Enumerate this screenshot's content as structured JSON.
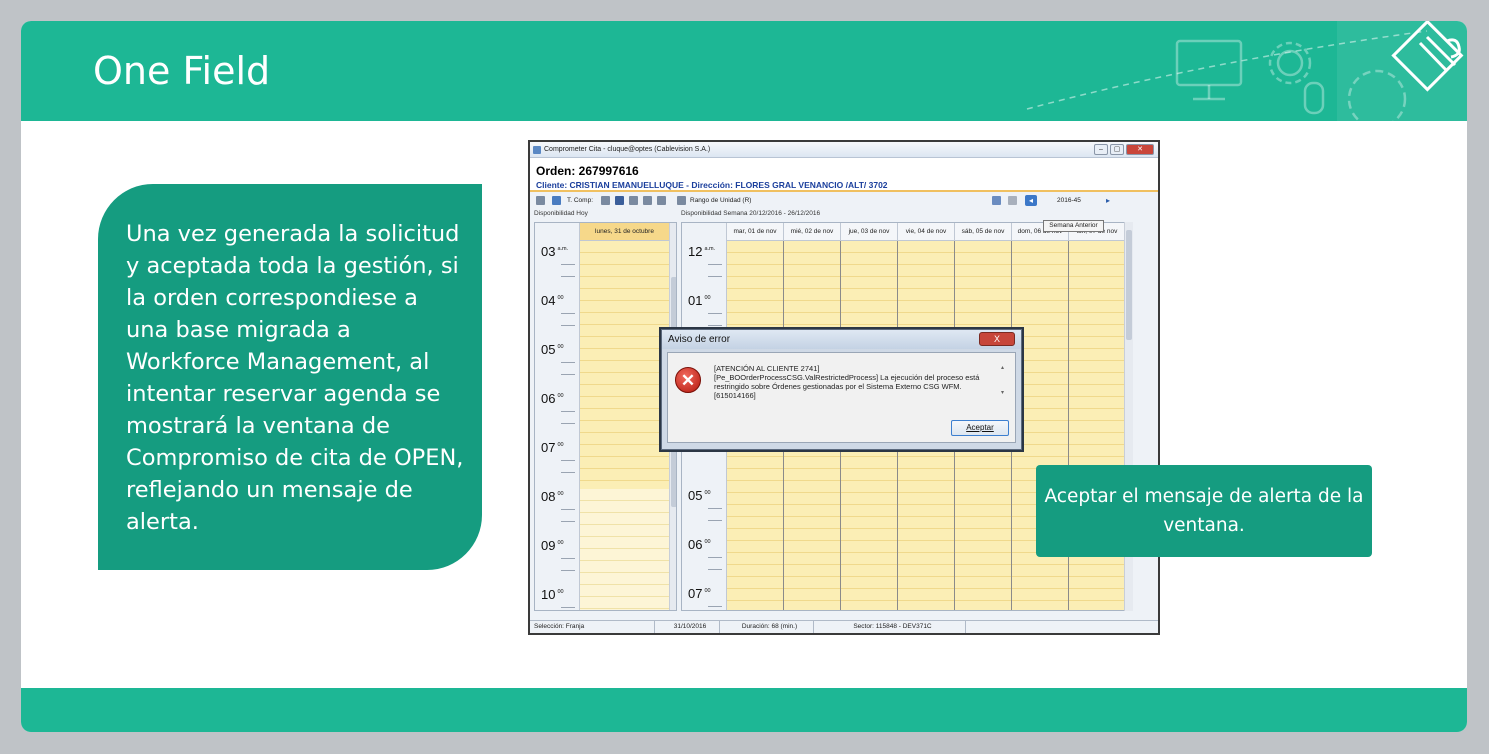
{
  "slide": {
    "title": "One Field",
    "left_callout": "Una vez generada la solicitud y aceptada toda la gestión, si la orden correspondiese a una base migrada a Workforce Management, al intentar reservar agenda se mostrará la ventana de Compromiso de cita de OPEN, reflejando un mensaje de alerta.",
    "right_callout": "Aceptar el mensaje de alerta de la ventana."
  },
  "window": {
    "title": "Comprometer Cita - cluque@optes (Cablevision S.A.)",
    "orden": "Orden: 267997616",
    "cliente": "Cliente: CRISTIAN EMANUELLUQUE - Dirección: FLORES GRAL VENANCIO /ALT/ 3702",
    "toolbar": {
      "t_comp": "T. Comp:",
      "rango": "Rango de Unidad (R)",
      "week": "2016-45",
      "tooltip": "Semana Anterior"
    },
    "labels": {
      "hoy": "Disponibilidad Hoy",
      "semana": "Disponibilidad Semana 20/12/2016 - 26/12/2016"
    },
    "today_header": "lunes, 31 de octubre",
    "days": [
      "mar, 01 de nov",
      "mié, 02 de nov",
      "jue, 03 de nov",
      "vie, 04 de nov",
      "sáb, 05 de nov",
      "dom, 06 de nov",
      "lun, 07 de nov"
    ],
    "left_hours": [
      {
        "h": "03",
        "s": "a.m."
      },
      {
        "h": "04",
        "s": "00"
      },
      {
        "h": "05",
        "s": "00"
      },
      {
        "h": "06",
        "s": "00"
      },
      {
        "h": "07",
        "s": "00"
      },
      {
        "h": "08",
        "s": "00"
      },
      {
        "h": "09",
        "s": "00"
      },
      {
        "h": "10",
        "s": "00"
      }
    ],
    "right_hours": [
      {
        "h": "12",
        "s": "a.m."
      },
      {
        "h": "01",
        "s": "00"
      },
      {
        "h": "05",
        "s": "00"
      },
      {
        "h": "06",
        "s": "00"
      },
      {
        "h": "07",
        "s": "00"
      }
    ],
    "status": {
      "seleccion": "Selección: Franja",
      "fecha": "31/10/2016",
      "duracion": "Duración: 68 (min.)",
      "sector": "Sector: 115848 - DEV371C"
    }
  },
  "dialog": {
    "title": "Aviso de error",
    "close": "X",
    "line1": "[ATENCIÓN AL CLIENTE 2741]",
    "line2": "[Pe_BOOrderProcessCSG.ValRestrictedProcess] La ejecución del proceso está restringido sobre Órdenes gestionadas por el Sistema Externo CSG WFM. [615014166]",
    "accept": "Aceptar"
  },
  "colors": {
    "header": "#1db795",
    "callout": "#159c80",
    "calendar": "#fbeeb5"
  }
}
